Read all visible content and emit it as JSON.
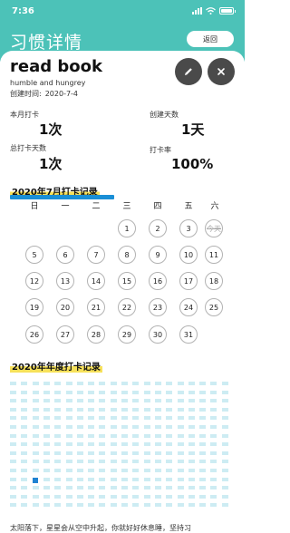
{
  "status": {
    "time": "7:36"
  },
  "header": {
    "title": "习惯详情",
    "back_label": "返回"
  },
  "habit": {
    "title": "read book",
    "subtitle": "humble and hungrey",
    "created_label": "创建时间:",
    "created_date": "2020-7-4"
  },
  "stats": {
    "month_checkin_label": "本月打卡",
    "month_checkin_value": "1次",
    "created_days_label": "创建天数",
    "created_days_value": "1天",
    "total_checkin_label": "总打卡天数",
    "total_checkin_value": "1次",
    "checkin_rate_label": "打卡率",
    "checkin_rate_value": "100%"
  },
  "month_section": {
    "title": "2020年7月打卡记录",
    "weekdays": [
      "日",
      "一",
      "二",
      "三",
      "四",
      "五",
      "六"
    ],
    "days": [
      "1",
      "2",
      "3",
      "今天",
      "5",
      "6",
      "7",
      "8",
      "9",
      "10",
      "11",
      "12",
      "13",
      "14",
      "15",
      "16",
      "17",
      "18",
      "19",
      "20",
      "21",
      "22",
      "23",
      "24",
      "25",
      "26",
      "27",
      "28",
      "29",
      "30",
      "31"
    ],
    "first_weekday": 3,
    "today": 4
  },
  "year_section": {
    "title": "2020年年度打卡记录",
    "rows": 15,
    "cols": 20,
    "checked_cells": [
      [
        11,
        2
      ]
    ]
  },
  "colors": {
    "header": "#4cc2b8",
    "year_cell": "#cdecf3",
    "year_cell_checked": "#1f82d2",
    "section_highlight": "#f7e15a",
    "round_button": "#4a4a4a"
  },
  "footer": {
    "text": "太阳落下，星星会从空中升起，你就好好休息睡，坚持习"
  }
}
